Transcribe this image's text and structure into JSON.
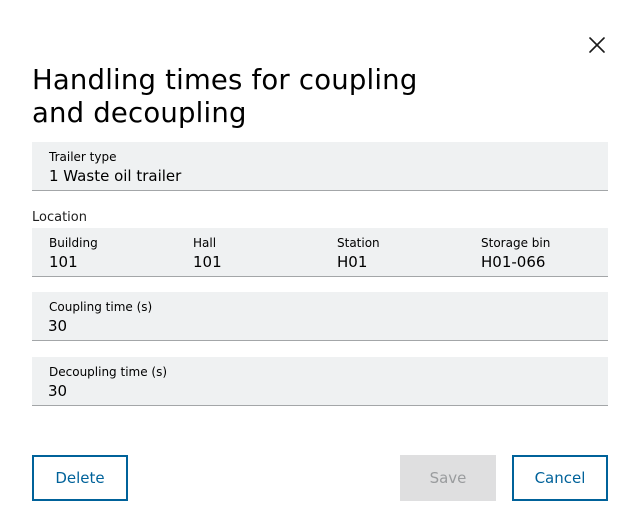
{
  "dialog": {
    "title": "Handling times for coupling and decoupling",
    "close_icon": "close-icon"
  },
  "trailer_type": {
    "label": "Trailer type",
    "value": "1 Waste oil trailer"
  },
  "location": {
    "section_label": "Location",
    "building": {
      "label": "Building",
      "value": "101"
    },
    "hall": {
      "label": "Hall",
      "value": "101"
    },
    "station": {
      "label": "Station",
      "value": "H01"
    },
    "storage_bin": {
      "label": "Storage bin",
      "value": "H01-066"
    }
  },
  "coupling_time": {
    "label": "Coupling time (s)",
    "value": "30"
  },
  "decoupling_time": {
    "label": "Decoupling time (s)",
    "value": "30"
  },
  "buttons": {
    "delete": "Delete",
    "save": "Save",
    "cancel": "Cancel"
  },
  "colors": {
    "accent": "#00629a",
    "field_background": "#eff1f2",
    "field_border": "#a3a6a8",
    "disabled_background": "#dfdfe0",
    "disabled_text": "#9a9c9e"
  }
}
